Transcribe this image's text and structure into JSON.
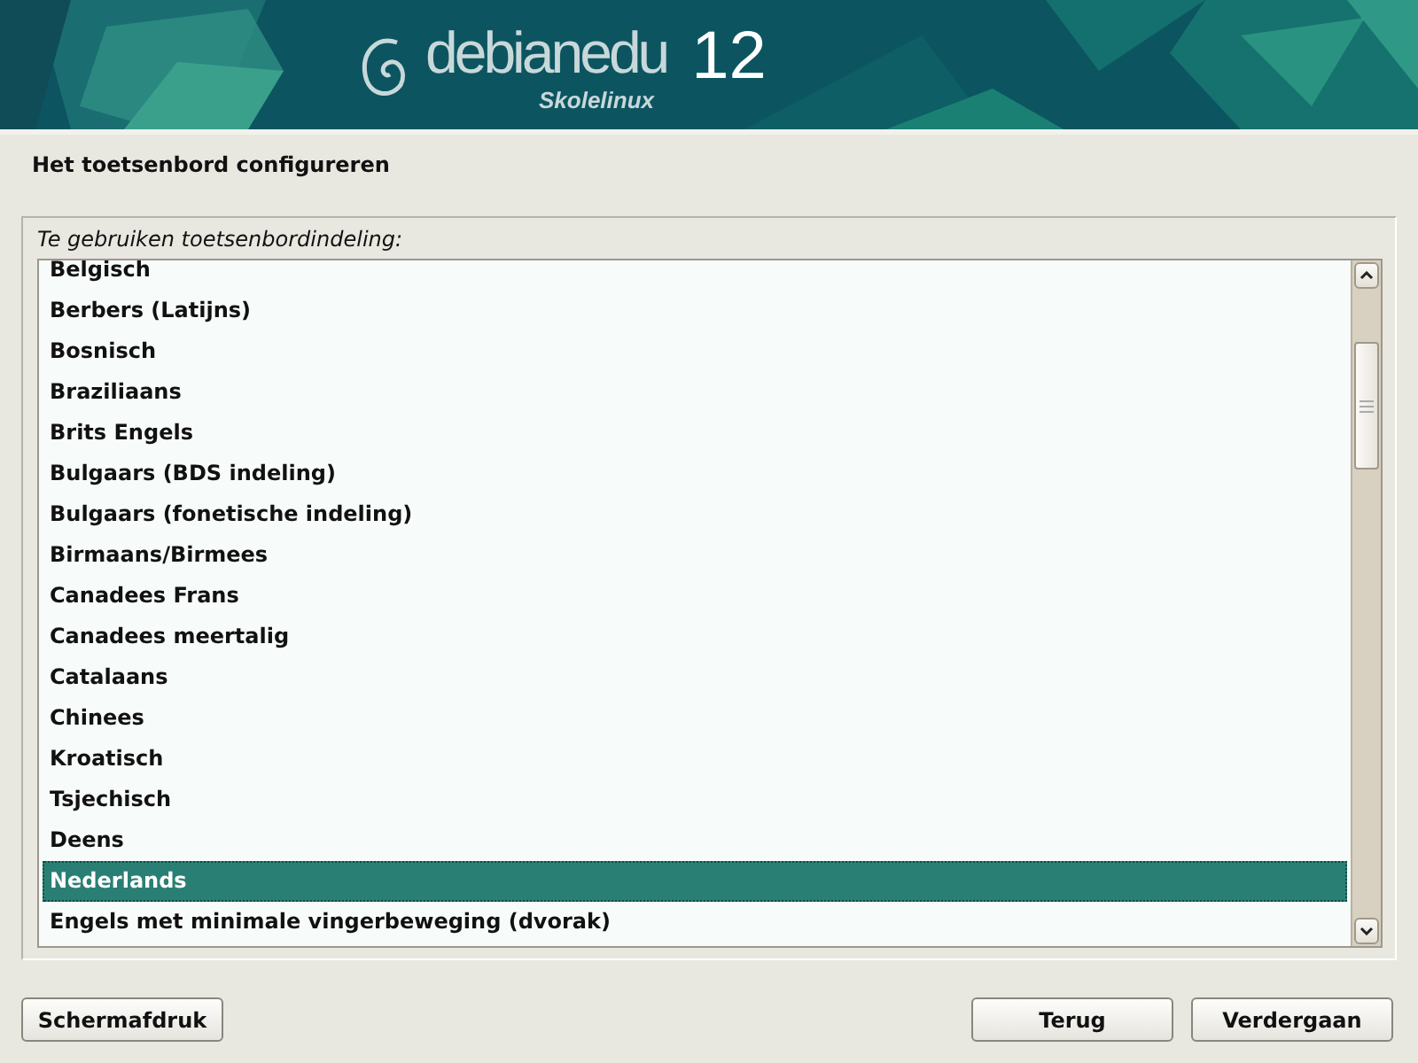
{
  "banner": {
    "brand": "debianedu",
    "version": "12",
    "subtitle": "Skolelinux"
  },
  "title": "Het toetsenbord configureren",
  "prompt": "Te gebruiken toetsenbordindeling:",
  "layouts": [
    {
      "label": "Belgisch",
      "selected": false
    },
    {
      "label": "Berbers (Latijns)",
      "selected": false
    },
    {
      "label": "Bosnisch",
      "selected": false
    },
    {
      "label": "Braziliaans",
      "selected": false
    },
    {
      "label": "Brits Engels",
      "selected": false
    },
    {
      "label": "Bulgaars (BDS indeling)",
      "selected": false
    },
    {
      "label": "Bulgaars (fonetische indeling)",
      "selected": false
    },
    {
      "label": "Birmaans/Birmees",
      "selected": false
    },
    {
      "label": "Canadees Frans",
      "selected": false
    },
    {
      "label": "Canadees meertalig",
      "selected": false
    },
    {
      "label": "Catalaans",
      "selected": false
    },
    {
      "label": "Chinees",
      "selected": false
    },
    {
      "label": "Kroatisch",
      "selected": false
    },
    {
      "label": "Tsjechisch",
      "selected": false
    },
    {
      "label": "Deens",
      "selected": false
    },
    {
      "label": "Nederlands",
      "selected": true
    },
    {
      "label": "Engels met minimale vingerbeweging (dvorak)",
      "selected": false
    }
  ],
  "buttons": {
    "left": [
      "Schermafdruk"
    ],
    "right": [
      "Terug",
      "Verdergaan"
    ]
  }
}
